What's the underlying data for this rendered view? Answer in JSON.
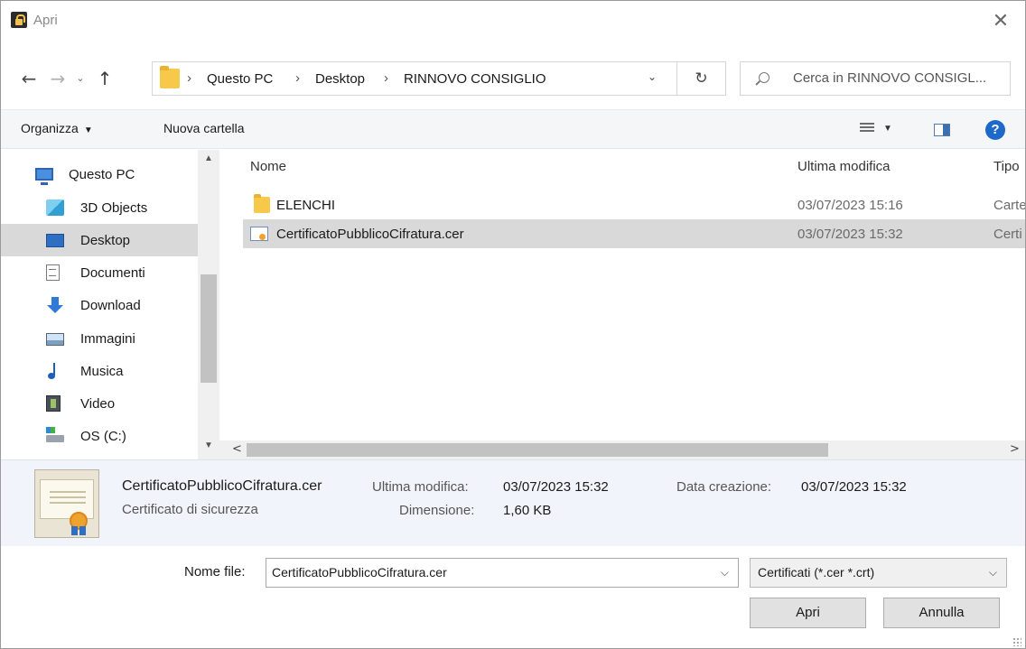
{
  "window": {
    "title": "Apri",
    "close_glyph": "✕",
    "icon": "lock-app-icon"
  },
  "nav": {
    "back": "←",
    "forward": "→",
    "recent": "⌄",
    "up": "↑",
    "breadcrumb": [
      {
        "label": "Questo PC"
      },
      {
        "label": "Desktop"
      },
      {
        "label": "RINNOVO CONSIGLIO"
      }
    ],
    "separator": "›",
    "dropdown": "⌄",
    "refresh": "↻",
    "search_placeholder": "Cerca in RINNOVO CONSIGL..."
  },
  "toolbar": {
    "organize": "Organizza",
    "organize_caret": "▼",
    "new_folder": "Nuova cartella",
    "view_caret": "▼",
    "help": "?"
  },
  "sidebar": {
    "items": [
      {
        "label": "Questo PC",
        "icon": "computer-icon"
      },
      {
        "label": "3D Objects",
        "icon": "3d-objects-icon"
      },
      {
        "label": "Desktop",
        "icon": "desktop-icon",
        "selected": true
      },
      {
        "label": "Documenti",
        "icon": "documents-icon"
      },
      {
        "label": "Download",
        "icon": "download-icon"
      },
      {
        "label": "Immagini",
        "icon": "pictures-icon"
      },
      {
        "label": "Musica",
        "icon": "music-icon"
      },
      {
        "label": "Video",
        "icon": "video-icon"
      },
      {
        "label": "OS (C:)",
        "icon": "drive-icon"
      }
    ],
    "scroll_up": "▲",
    "scroll_down": "▼"
  },
  "filelist": {
    "columns": {
      "name": "Nome",
      "modified": "Ultima modifica",
      "type": "Tipo"
    },
    "sort_caret": "^",
    "rows": [
      {
        "name": "ELENCHI",
        "modified": "03/07/2023 15:16",
        "type": "Carte",
        "icon": "folder-icon"
      },
      {
        "name": "CertificatoPubblicoCifratura.cer",
        "modified": "03/07/2023 15:32",
        "type": "Certi",
        "icon": "certificate-icon",
        "selected": true
      }
    ],
    "scroll_left": "<",
    "scroll_right": ">"
  },
  "details": {
    "filename": "CertificatoPubblicoCifratura.cer",
    "filetype": "Certificato di sicurezza",
    "modified_label": "Ultima modifica:",
    "modified_value": "03/07/2023 15:32",
    "size_label": "Dimensione:",
    "size_value": "1,60 KB",
    "created_label": "Data creazione:",
    "created_value": "03/07/2023 15:32"
  },
  "footer": {
    "filename_label": "Nome file:",
    "filename_value": "CertificatoPubblicoCifratura.cer",
    "filter": "Certificati (*.cer *.crt)",
    "caret": "⌵",
    "open": "Apri",
    "cancel": "Annulla"
  },
  "colors": {
    "selection": "#d9d9d9",
    "details_bg": "#f1f5fb",
    "toolbar_bg": "#f5f6f8",
    "help_blue": "#1d69c9",
    "folder": "#f6c94a"
  }
}
